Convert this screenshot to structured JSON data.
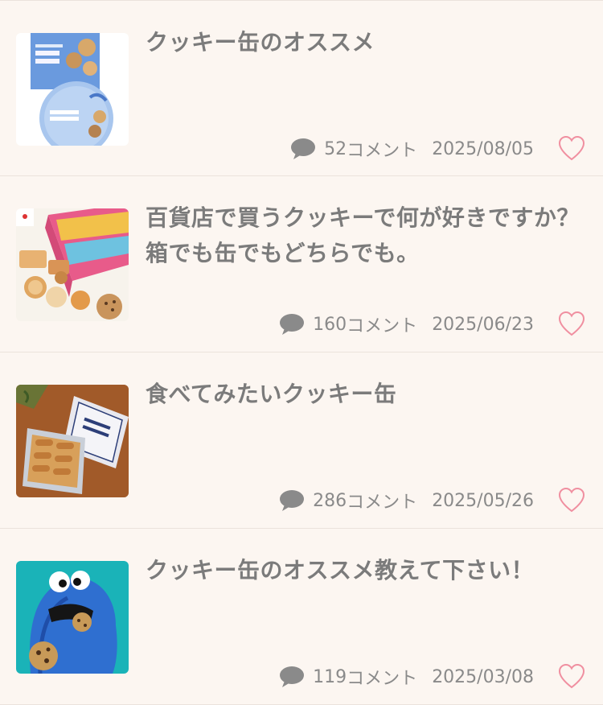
{
  "items": [
    {
      "title": "クッキー缶のオススメ",
      "count_number": "52",
      "count_suffix": "コメント",
      "date": "2025/08/05",
      "thumb_icon": "butter-cookies-box-thumbnail"
    },
    {
      "title": "百貨店で買うクッキーで何が好きですか？箱でも缶でもどちらでも。",
      "count_number": "160",
      "count_suffix": "コメント",
      "date": "2025/06/23",
      "thumb_icon": "assorted-cookies-thumbnail"
    },
    {
      "title": "食べてみたいクッキー缶",
      "count_number": "286",
      "count_suffix": "コメント",
      "date": "2025/05/26",
      "thumb_icon": "cookie-tin-thumbnail"
    },
    {
      "title": "クッキー缶のオススメ教えて下さい！",
      "count_number": "119",
      "count_suffix": "コメント",
      "date": "2025/03/08",
      "thumb_icon": "cookie-monster-thumbnail"
    }
  ],
  "colors": {
    "background": "#fcf6f1",
    "text": "#7b7b7b",
    "comment_icon": "#8a8a8a",
    "heart": "#f08fa0",
    "divider": "#ebe3dc"
  }
}
